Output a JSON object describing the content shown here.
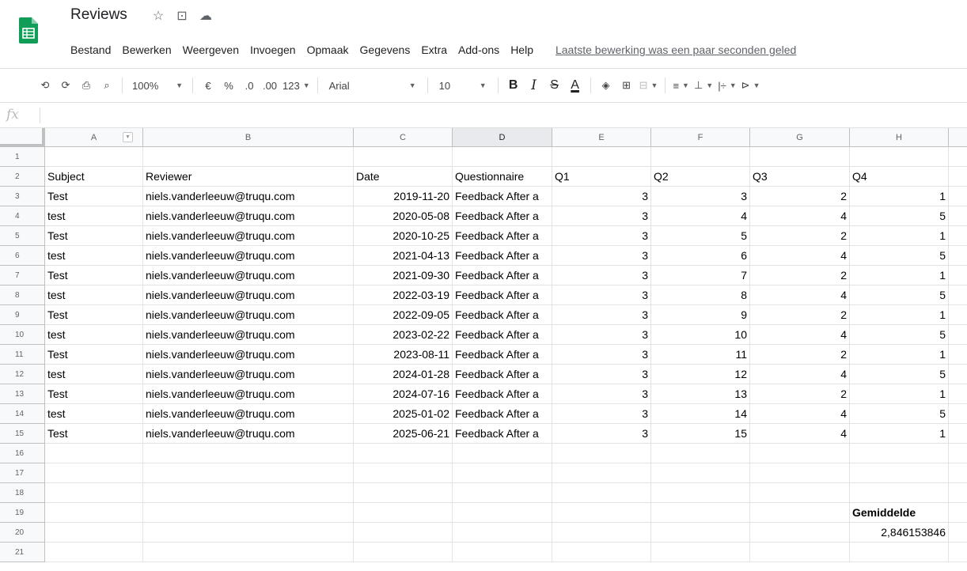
{
  "header": {
    "title": "Reviews",
    "star_icon": "☆",
    "move_icon": "⊡",
    "cloud_icon": "☁",
    "brand_color": "#0f9d58"
  },
  "menu": [
    "Bestand",
    "Bewerken",
    "Weergeven",
    "Invoegen",
    "Opmaak",
    "Gegevens",
    "Extra",
    "Add-ons",
    "Help"
  ],
  "last_edit": "Laatste bewerking was een paar seconden geled",
  "toolbar": {
    "undo": "⟲",
    "redo": "⟳",
    "print": "⎙",
    "paint_format": "⌕",
    "zoom": "100%",
    "currency": "€",
    "percent": "%",
    "decrease_decimals": ".0",
    "increase_decimals": ".00",
    "more_formats": "123",
    "font": "Arial",
    "font_size": "10",
    "bold": "B",
    "italic": "I",
    "strikethrough": "S",
    "text_color": "A",
    "fill_color": "◈",
    "borders": "⊞",
    "merge": "⊟",
    "align_h": "≡",
    "align_v": "⊥",
    "wrap": "|÷",
    "rotate": "⊳"
  },
  "formula_bar": {
    "fx": "fx",
    "value": ""
  },
  "columns": [
    "A",
    "B",
    "C",
    "D",
    "E",
    "F",
    "G",
    "H",
    ""
  ],
  "rows": [
    {
      "n": "1",
      "cells": [
        "",
        "",
        "",
        "",
        "",
        "",
        "",
        "",
        ""
      ]
    },
    {
      "n": "2",
      "cells": [
        "Subject",
        "Reviewer",
        "Date",
        "Questionnaire",
        "Q1",
        "Q2",
        "Q3",
        "Q4",
        ""
      ]
    },
    {
      "n": "3",
      "cells": [
        "Test",
        "niels.vanderleeuw@truqu.com",
        "2019-11-20",
        "Feedback After a",
        "3",
        "3",
        "2",
        "1",
        ""
      ]
    },
    {
      "n": "4",
      "cells": [
        "test",
        "niels.vanderleeuw@truqu.com",
        "2020-05-08",
        "Feedback After a",
        "3",
        "4",
        "4",
        "5",
        ""
      ]
    },
    {
      "n": "5",
      "cells": [
        "Test",
        "niels.vanderleeuw@truqu.com",
        "2020-10-25",
        "Feedback After a",
        "3",
        "5",
        "2",
        "1",
        ""
      ]
    },
    {
      "n": "6",
      "cells": [
        "test",
        "niels.vanderleeuw@truqu.com",
        "2021-04-13",
        "Feedback After a",
        "3",
        "6",
        "4",
        "5",
        ""
      ]
    },
    {
      "n": "7",
      "cells": [
        "Test",
        "niels.vanderleeuw@truqu.com",
        "2021-09-30",
        "Feedback After a",
        "3",
        "7",
        "2",
        "1",
        ""
      ]
    },
    {
      "n": "8",
      "cells": [
        "test",
        "niels.vanderleeuw@truqu.com",
        "2022-03-19",
        "Feedback After a",
        "3",
        "8",
        "4",
        "5",
        ""
      ]
    },
    {
      "n": "9",
      "cells": [
        "Test",
        "niels.vanderleeuw@truqu.com",
        "2022-09-05",
        "Feedback After a",
        "3",
        "9",
        "2",
        "1",
        ""
      ]
    },
    {
      "n": "10",
      "cells": [
        "test",
        "niels.vanderleeuw@truqu.com",
        "2023-02-22",
        "Feedback After a",
        "3",
        "10",
        "4",
        "5",
        ""
      ]
    },
    {
      "n": "11",
      "cells": [
        "Test",
        "niels.vanderleeuw@truqu.com",
        "2023-08-11",
        "Feedback After a",
        "3",
        "11",
        "2",
        "1",
        ""
      ]
    },
    {
      "n": "12",
      "cells": [
        "test",
        "niels.vanderleeuw@truqu.com",
        "2024-01-28",
        "Feedback After a",
        "3",
        "12",
        "4",
        "5",
        ""
      ]
    },
    {
      "n": "13",
      "cells": [
        "Test",
        "niels.vanderleeuw@truqu.com",
        "2024-07-16",
        "Feedback After a",
        "3",
        "13",
        "2",
        "1",
        ""
      ]
    },
    {
      "n": "14",
      "cells": [
        "test",
        "niels.vanderleeuw@truqu.com",
        "2025-01-02",
        "Feedback After a",
        "3",
        "14",
        "4",
        "5",
        ""
      ]
    },
    {
      "n": "15",
      "cells": [
        "Test",
        "niels.vanderleeuw@truqu.com",
        "2025-06-21",
        "Feedback After a",
        "3",
        "15",
        "4",
        "1",
        ""
      ]
    },
    {
      "n": "16",
      "cells": [
        "",
        "",
        "",
        "",
        "",
        "",
        "",
        "",
        ""
      ]
    },
    {
      "n": "17",
      "cells": [
        "",
        "",
        "",
        "",
        "",
        "",
        "",
        "",
        ""
      ]
    },
    {
      "n": "18",
      "cells": [
        "",
        "",
        "",
        "",
        "",
        "",
        "",
        "",
        ""
      ]
    },
    {
      "n": "19",
      "cells": [
        "",
        "",
        "",
        "",
        "",
        "",
        "",
        "Gemiddelde",
        ""
      ]
    },
    {
      "n": "20",
      "cells": [
        "",
        "",
        "",
        "",
        "",
        "",
        "",
        "2,846153846",
        ""
      ]
    },
    {
      "n": "21",
      "cells": [
        "",
        "",
        "",
        "",
        "",
        "",
        "",
        "",
        ""
      ]
    }
  ]
}
